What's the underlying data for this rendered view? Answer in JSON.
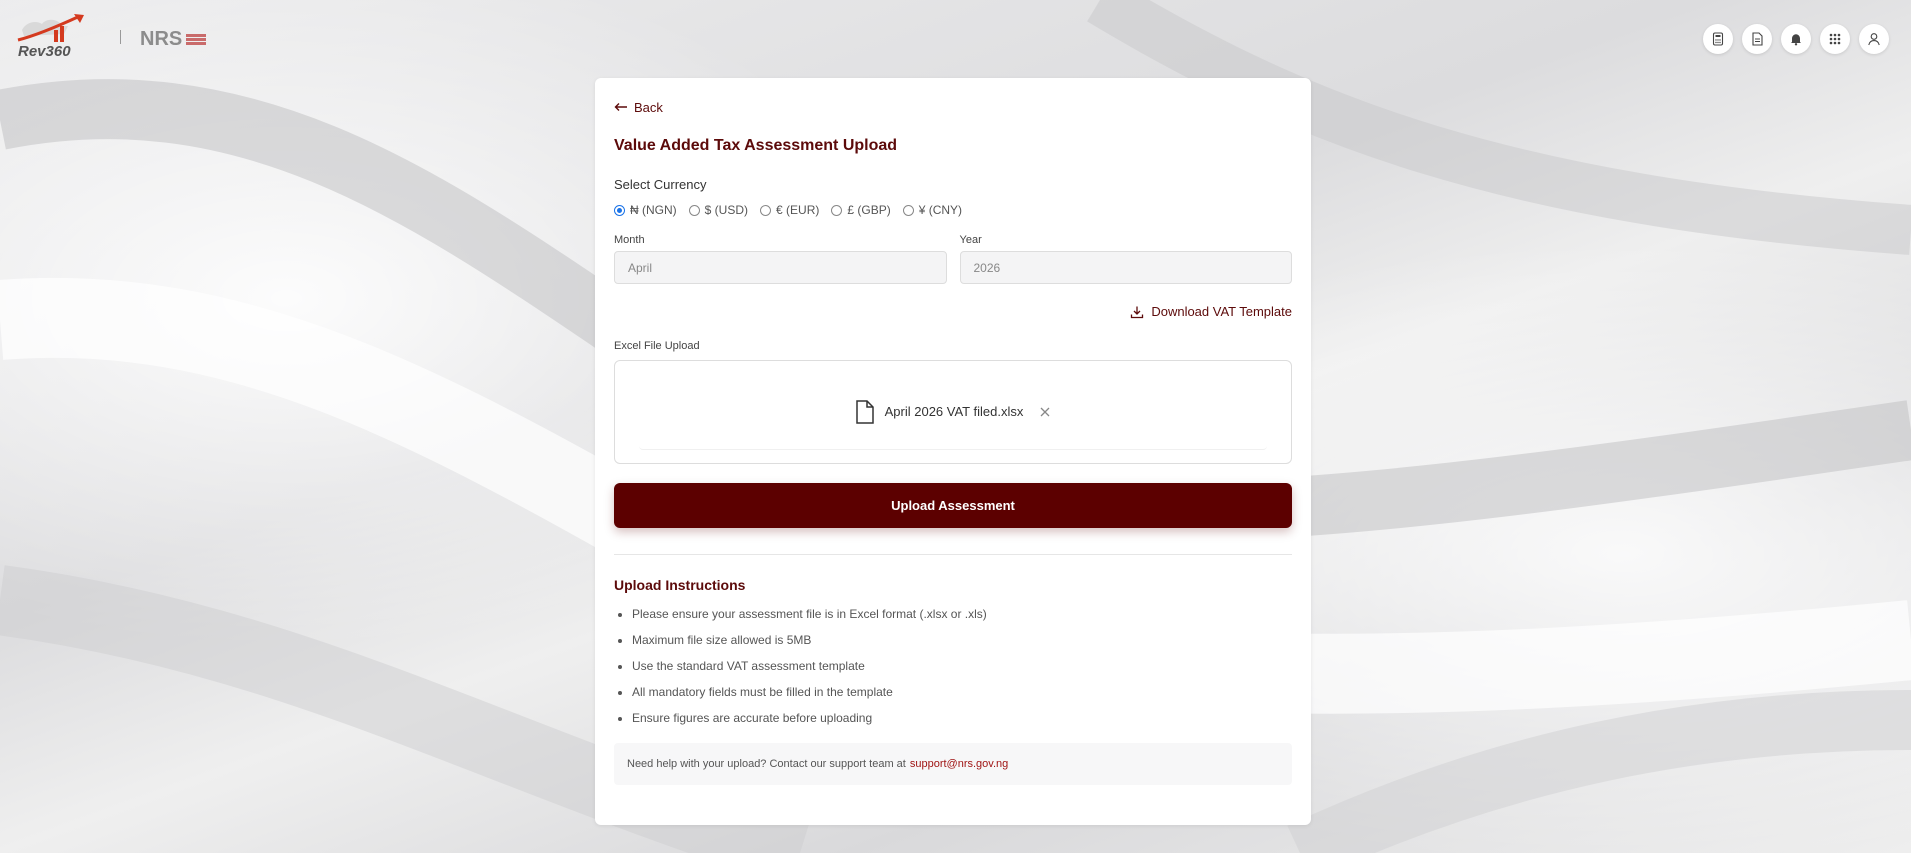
{
  "header": {
    "brand_primary": "Rev360",
    "brand_secondary": "NRS",
    "icons": [
      "calculator-icon",
      "document-icon",
      "bell-icon",
      "apps-grid-icon",
      "user-icon"
    ]
  },
  "card": {
    "back_label": "Back",
    "title": "Value Added Tax Assessment Upload",
    "currency_label": "Select Currency",
    "currencies": [
      {
        "label": "₦ (NGN)",
        "checked": true
      },
      {
        "label": "$ (USD)",
        "checked": false
      },
      {
        "label": "€ (EUR)",
        "checked": false
      },
      {
        "label": "£ (GBP)",
        "checked": false
      },
      {
        "label": "¥ (CNY)",
        "checked": false
      }
    ],
    "month_label": "Month",
    "month_value": "April",
    "year_label": "Year",
    "year_value": "2026",
    "download_label": "Download VAT Template",
    "upload_label": "Excel File Upload",
    "file_name": "April 2026 VAT filed.xlsx",
    "upload_button": "Upload Assessment",
    "instructions_title": "Upload Instructions",
    "instructions": [
      "Please ensure your assessment file is in Excel format (.xlsx or .xls)",
      "Maximum file size allowed is 5MB",
      "Use the standard VAT assessment template",
      "All mandatory fields must be filled in the template",
      "Ensure figures are accurate before uploading"
    ],
    "help_text": "Need help with your upload? Contact our support team at",
    "help_email": "support@nrs.gov.ng"
  },
  "colors": {
    "accent": "#5c0000",
    "accent_text": "#5c0a0a",
    "radio_selected": "#1a73e8"
  }
}
